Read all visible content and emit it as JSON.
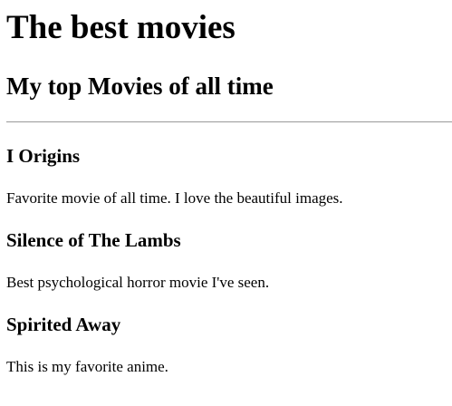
{
  "page": {
    "heading": "The best movies",
    "subheading": "My top Movies of all time"
  },
  "movies": [
    {
      "title": "I Origins",
      "description": "Favorite movie of all time. I love the beautiful images."
    },
    {
      "title": "Silence of The Lambs",
      "description": "Best psychological horror movie I've seen."
    },
    {
      "title": "Spirited Away",
      "description": "This is my favorite anime."
    }
  ]
}
